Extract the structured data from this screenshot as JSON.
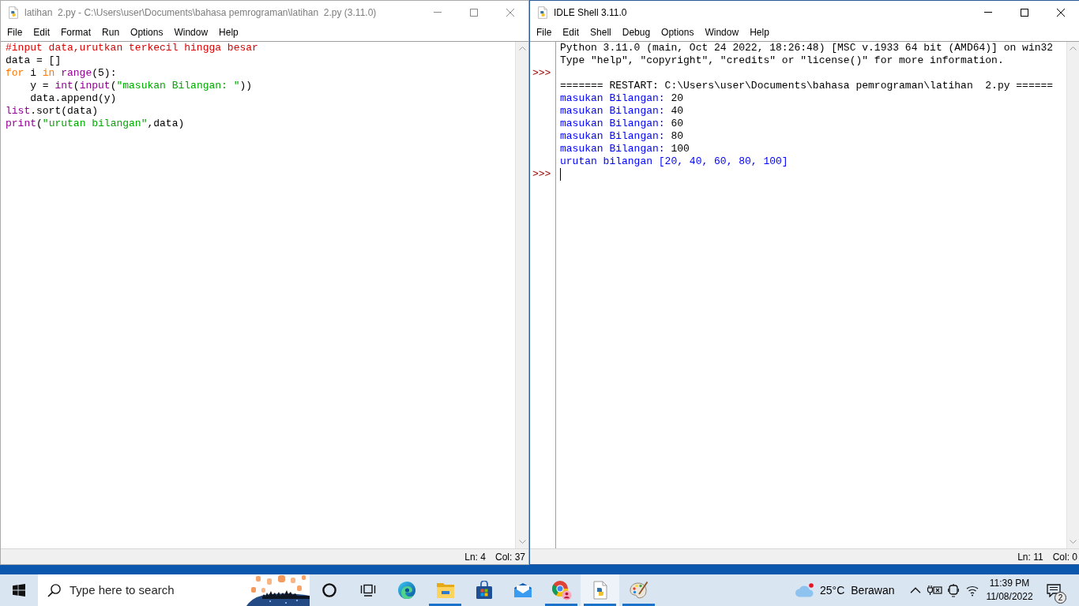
{
  "editor_window": {
    "title": "latihan  2.py - C:\\Users\\user\\Documents\\bahasa pemrograman\\latihan  2.py (3.11.0)",
    "active": false,
    "menu": [
      "File",
      "Edit",
      "Format",
      "Run",
      "Options",
      "Window",
      "Help"
    ],
    "code_lines": [
      [
        {
          "kind": "comment",
          "text": "#input data,urutkan terkecil hingga besar"
        }
      ],
      [
        {
          "kind": "plain",
          "text": "data = []"
        }
      ],
      [
        {
          "kind": "keyword",
          "text": "for"
        },
        {
          "kind": "plain",
          "text": " i "
        },
        {
          "kind": "keyword",
          "text": "in "
        },
        {
          "kind": "builtin",
          "text": "range"
        },
        {
          "kind": "plain",
          "text": "(5):"
        }
      ],
      [
        {
          "kind": "plain",
          "text": "    y = "
        },
        {
          "kind": "builtin",
          "text": "int"
        },
        {
          "kind": "plain",
          "text": "("
        },
        {
          "kind": "builtin",
          "text": "input"
        },
        {
          "kind": "plain",
          "text": "("
        },
        {
          "kind": "string",
          "text": "\"masukan Bilangan: \""
        },
        {
          "kind": "plain",
          "text": "))"
        }
      ],
      [
        {
          "kind": "plain",
          "text": "    data.append(y)"
        }
      ],
      [
        {
          "kind": "builtin",
          "text": "list"
        },
        {
          "kind": "plain",
          "text": ".sort(data)"
        }
      ],
      [
        {
          "kind": "builtin",
          "text": "print"
        },
        {
          "kind": "plain",
          "text": "("
        },
        {
          "kind": "string",
          "text": "\"urutan bilangan\""
        },
        {
          "kind": "plain",
          "text": ",data)"
        }
      ]
    ],
    "status": {
      "line": "Ln: 4",
      "column": "Col: 37"
    }
  },
  "shell_window": {
    "title": "IDLE Shell 3.11.0",
    "active": true,
    "menu": [
      "File",
      "Edit",
      "Shell",
      "Debug",
      "Options",
      "Window",
      "Help"
    ],
    "lines": [
      {
        "segments": [
          {
            "kind": "plain",
            "text": "Python 3.11.0 (main, Oct 24 2022, 18:26:48) [MSC v.1933 64 bit (AMD64)] on win32"
          }
        ]
      },
      {
        "segments": [
          {
            "kind": "plain",
            "text": "Type \"help\", \"copyright\", \"credits\" or \"license()\" for more information."
          }
        ]
      },
      {
        "prompt": ">>>"
      },
      {
        "segments": [
          {
            "kind": "plain",
            "text": "======= RESTART: C:\\Users\\user\\Documents\\bahasa pemrograman\\latihan  2.py ======"
          }
        ]
      },
      {
        "segments": [
          {
            "kind": "stdout",
            "text": "masukan Bilangan: "
          },
          {
            "kind": "plain",
            "text": "20"
          }
        ]
      },
      {
        "segments": [
          {
            "kind": "stdout",
            "text": "masukan Bilangan: "
          },
          {
            "kind": "plain",
            "text": "40"
          }
        ]
      },
      {
        "segments": [
          {
            "kind": "stdout",
            "text": "masukan Bilangan: "
          },
          {
            "kind": "plain",
            "text": "60"
          }
        ]
      },
      {
        "segments": [
          {
            "kind": "stdout",
            "text": "masukan Bilangan: "
          },
          {
            "kind": "plain",
            "text": "80"
          }
        ]
      },
      {
        "segments": [
          {
            "kind": "stdout",
            "text": "masukan Bilangan: "
          },
          {
            "kind": "plain",
            "text": "100"
          }
        ]
      },
      {
        "segments": [
          {
            "kind": "stdout",
            "text": "urutan bilangan [20, 40, 60, 80, 100]"
          }
        ]
      }
    ],
    "input_line": {
      "prompt": ">>>",
      "cursor": true
    },
    "status": {
      "line": "Ln: 11",
      "column": "Col: 0"
    }
  },
  "taskbar": {
    "search": {
      "placeholder": "Type here to search"
    },
    "apps": [
      {
        "kind": "cortana",
        "running": false,
        "active": false
      },
      {
        "kind": "task_view",
        "running": false,
        "active": false
      },
      {
        "kind": "edge",
        "running": false,
        "active": false
      },
      {
        "kind": "explorer",
        "running": true,
        "active": false
      },
      {
        "kind": "store",
        "running": false,
        "active": false
      },
      {
        "kind": "mail",
        "running": false,
        "active": false
      },
      {
        "kind": "chrome",
        "running": true,
        "active": false
      },
      {
        "kind": "idle",
        "running": true,
        "active": true
      },
      {
        "kind": "paint",
        "running": true,
        "active": false
      }
    ],
    "weather": {
      "temperature": "25°C",
      "condition": "Berawan"
    },
    "clock": {
      "time": "11:39 PM",
      "date": "11/08/2022"
    },
    "notification_count": "2"
  }
}
